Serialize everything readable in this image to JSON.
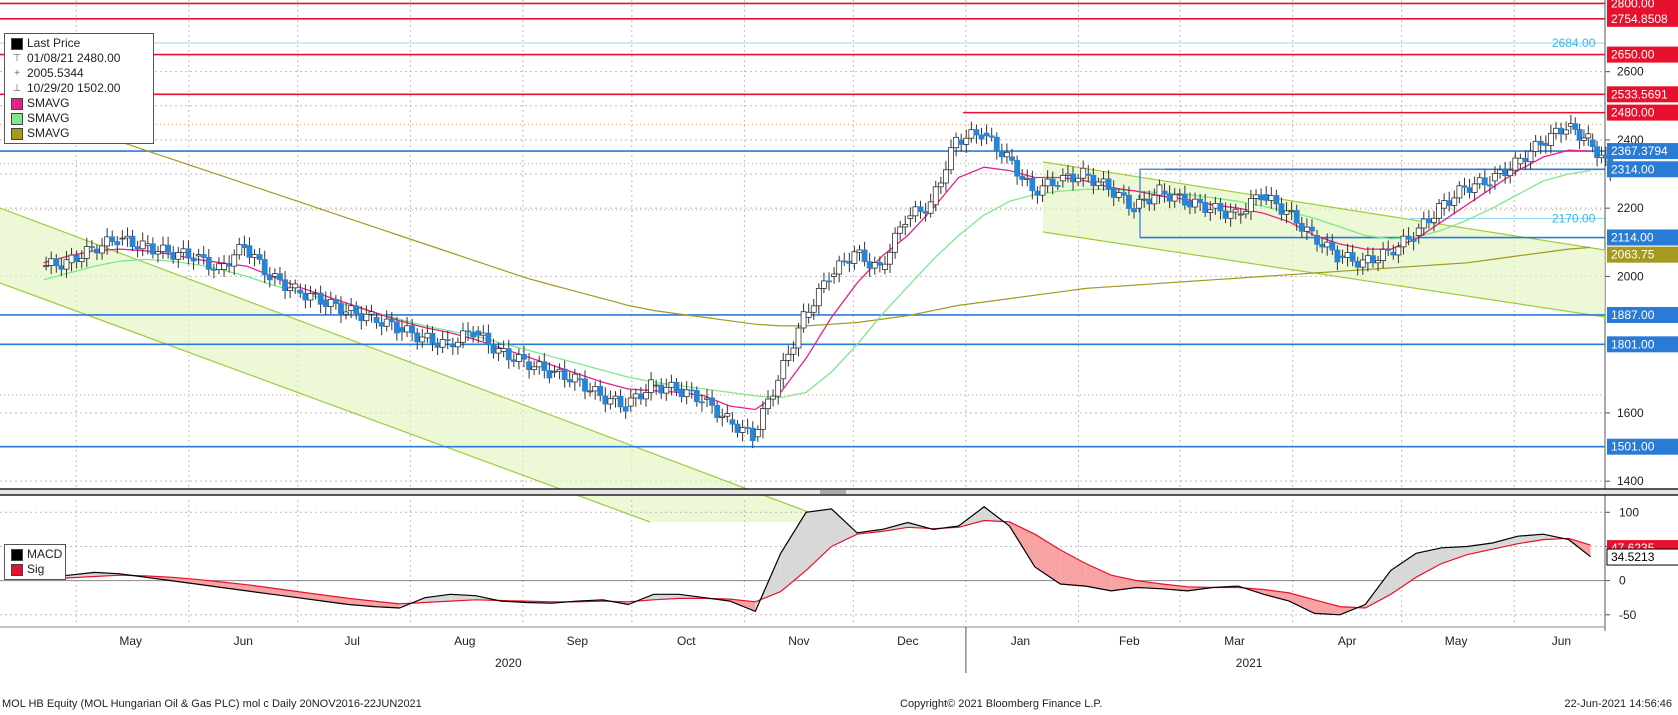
{
  "chart_data": {
    "type": "candlestick",
    "price_panel": {
      "yticks": [
        1400,
        1600,
        2000,
        2200,
        2400,
        2600
      ],
      "ylim": [
        1380,
        2810
      ],
      "candles_weekly_close": [
        {
          "date": "2020-04-22",
          "value": 2040
        },
        {
          "date": "2020-04-29",
          "value": 2080
        },
        {
          "date": "2020-05-06",
          "value": 2110
        },
        {
          "date": "2020-05-13",
          "value": 2090
        },
        {
          "date": "2020-05-20",
          "value": 2070
        },
        {
          "date": "2020-05-27",
          "value": 2060
        },
        {
          "date": "2020-06-03",
          "value": 2020
        },
        {
          "date": "2020-06-10",
          "value": 2090
        },
        {
          "date": "2020-06-17",
          "value": 2000
        },
        {
          "date": "2020-06-24",
          "value": 1960
        },
        {
          "date": "2020-07-01",
          "value": 1930
        },
        {
          "date": "2020-07-08",
          "value": 1900
        },
        {
          "date": "2020-07-15",
          "value": 1880
        },
        {
          "date": "2020-07-22",
          "value": 1850
        },
        {
          "date": "2020-07-29",
          "value": 1820
        },
        {
          "date": "2020-08-05",
          "value": 1800
        },
        {
          "date": "2020-08-12",
          "value": 1840
        },
        {
          "date": "2020-08-19",
          "value": 1780
        },
        {
          "date": "2020-08-26",
          "value": 1750
        },
        {
          "date": "2020-09-02",
          "value": 1720
        },
        {
          "date": "2020-09-09",
          "value": 1700
        },
        {
          "date": "2020-09-16",
          "value": 1650
        },
        {
          "date": "2020-09-23",
          "value": 1620
        },
        {
          "date": "2020-09-30",
          "value": 1680
        },
        {
          "date": "2020-10-07",
          "value": 1670
        },
        {
          "date": "2020-10-14",
          "value": 1640
        },
        {
          "date": "2020-10-21",
          "value": 1580
        },
        {
          "date": "2020-10-28",
          "value": 1530
        },
        {
          "date": "2020-11-04",
          "value": 1700
        },
        {
          "date": "2020-11-11",
          "value": 1880
        },
        {
          "date": "2020-11-18",
          "value": 2000
        },
        {
          "date": "2020-11-25",
          "value": 2070
        },
        {
          "date": "2020-12-02",
          "value": 2020
        },
        {
          "date": "2020-12-09",
          "value": 2170
        },
        {
          "date": "2020-12-16",
          "value": 2210
        },
        {
          "date": "2020-12-23",
          "value": 2400
        },
        {
          "date": "2020-12-30",
          "value": 2420
        },
        {
          "date": "2021-01-06",
          "value": 2350
        },
        {
          "date": "2021-01-13",
          "value": 2250
        },
        {
          "date": "2021-01-20",
          "value": 2280
        },
        {
          "date": "2021-01-27",
          "value": 2300
        },
        {
          "date": "2021-02-03",
          "value": 2260
        },
        {
          "date": "2021-02-10",
          "value": 2200
        },
        {
          "date": "2021-02-17",
          "value": 2250
        },
        {
          "date": "2021-02-24",
          "value": 2220
        },
        {
          "date": "2021-03-03",
          "value": 2200
        },
        {
          "date": "2021-03-10",
          "value": 2180
        },
        {
          "date": "2021-03-17",
          "value": 2240
        },
        {
          "date": "2021-03-24",
          "value": 2190
        },
        {
          "date": "2021-03-31",
          "value": 2120
        },
        {
          "date": "2021-04-07",
          "value": 2060
        },
        {
          "date": "2021-04-14",
          "value": 2040
        },
        {
          "date": "2021-04-21",
          "value": 2070
        },
        {
          "date": "2021-04-28",
          "value": 2120
        },
        {
          "date": "2021-05-05",
          "value": 2200
        },
        {
          "date": "2021-05-12",
          "value": 2260
        },
        {
          "date": "2021-05-19",
          "value": 2280
        },
        {
          "date": "2021-05-26",
          "value": 2330
        },
        {
          "date": "2021-06-02",
          "value": 2390
        },
        {
          "date": "2021-06-09",
          "value": 2440
        },
        {
          "date": "2021-06-16",
          "value": 2400
        },
        {
          "date": "2021-06-22",
          "value": 2314
        }
      ],
      "sma_20": [
        2040,
        2060,
        2075,
        2080,
        2075,
        2065,
        2050,
        2040,
        2030,
        2000,
        1970,
        1945,
        1920,
        1895,
        1870,
        1850,
        1835,
        1815,
        1790,
        1765,
        1740,
        1715,
        1690,
        1670,
        1665,
        1660,
        1650,
        1620,
        1610,
        1660,
        1760,
        1880,
        1980,
        2060,
        2120,
        2200,
        2290,
        2320,
        2310,
        2290,
        2290,
        2280,
        2260,
        2250,
        2235,
        2225,
        2210,
        2200,
        2185,
        2160,
        2120,
        2095,
        2080,
        2080,
        2110,
        2160,
        2210,
        2260,
        2310,
        2350,
        2370,
        2367
      ],
      "sma_50": [
        1990,
        2010,
        2030,
        2045,
        2050,
        2045,
        2035,
        2020,
        2000,
        1975,
        1955,
        1935,
        1915,
        1895,
        1875,
        1855,
        1840,
        1825,
        1805,
        1785,
        1765,
        1745,
        1725,
        1705,
        1690,
        1680,
        1670,
        1660,
        1650,
        1645,
        1660,
        1720,
        1800,
        1890,
        1970,
        2050,
        2120,
        2180,
        2220,
        2240,
        2250,
        2255,
        2255,
        2250,
        2245,
        2240,
        2230,
        2220,
        2205,
        2190,
        2170,
        2145,
        2120,
        2110,
        2115,
        2135,
        2165,
        2200,
        2240,
        2280,
        2300,
        2310
      ],
      "sma_200": [
        2460,
        2440,
        2420,
        2395,
        2370,
        2345,
        2320,
        2295,
        2270,
        2245,
        2220,
        2195,
        2170,
        2145,
        2120,
        2095,
        2070,
        2045,
        2020,
        1995,
        1975,
        1955,
        1935,
        1915,
        1900,
        1890,
        1880,
        1870,
        1860,
        1855,
        1855,
        1860,
        1865,
        1875,
        1885,
        1900,
        1915,
        1925,
        1935,
        1945,
        1955,
        1965,
        1970,
        1975,
        1980,
        1985,
        1990,
        1995,
        2000,
        2005,
        2010,
        2015,
        2020,
        2025,
        2030,
        2035,
        2040,
        2050,
        2060,
        2070,
        2080,
        2085
      ],
      "horizontal_levels": [
        {
          "value": 2800,
          "label": "2800.00",
          "color": "#e8112d"
        },
        {
          "value": 2754.85,
          "label": "2754.8508",
          "color": "#e8112d"
        },
        {
          "value": 2684,
          "label": "2684.00",
          "color": "#36b6e8"
        },
        {
          "value": 2650,
          "label": "2650.00",
          "color": "#e8112d"
        },
        {
          "value": 2533.57,
          "label": "2533.5691",
          "color": "#e8112d"
        },
        {
          "value": 2480,
          "label": "2480.00",
          "color": "#e8112d"
        },
        {
          "value": 2367.38,
          "label": "2367.3794",
          "color": "#2a7bd6"
        },
        {
          "value": 2314,
          "label": "2314.00",
          "color": "#2a7bd6"
        },
        {
          "value": 2170,
          "label": "2170.00",
          "color": "#36b6e8"
        },
        {
          "value": 2114,
          "label": "2114.00",
          "color": "#2a7bd6"
        },
        {
          "value": 2063.75,
          "label": "2063.75",
          "color": "#a39a1e"
        },
        {
          "value": 1887,
          "label": "1887.00",
          "color": "#2a7bd6"
        },
        {
          "value": 1801,
          "label": "1801.00",
          "color": "#2a7bd6"
        },
        {
          "value": 1501,
          "label": "1501.00",
          "color": "#2a7bd6"
        }
      ],
      "legend": {
        "title": "Last Price",
        "high": "01/08/21 2480.00",
        "average": "2005.5344",
        "low": "10/29/20 1502.00",
        "series": [
          {
            "name": "SMAVG",
            "color": "#e8208e"
          },
          {
            "name": "SMAVG",
            "color": "#7fe88a"
          },
          {
            "name": "SMAVG",
            "color": "#a39a1e"
          }
        ]
      }
    },
    "macd_panel": {
      "yticks": [
        -50,
        0,
        50,
        100
      ],
      "ylim": [
        -62,
        118
      ],
      "macd": [
        5,
        8,
        12,
        10,
        5,
        0,
        -5,
        -10,
        -15,
        -20,
        -25,
        -30,
        -35,
        -38,
        -40,
        -25,
        -20,
        -22,
        -30,
        -32,
        -33,
        -30,
        -28,
        -35,
        -20,
        -20,
        -25,
        -30,
        -45,
        40,
        100,
        105,
        70,
        75,
        85,
        75,
        80,
        108,
        80,
        20,
        -5,
        -8,
        -15,
        -10,
        -12,
        -15,
        -10,
        -8,
        -20,
        -30,
        -48,
        -50,
        -35,
        15,
        40,
        48,
        50,
        55,
        65,
        68,
        60,
        35
      ],
      "signal": [
        2,
        4,
        6,
        8,
        7,
        5,
        2,
        -2,
        -6,
        -11,
        -16,
        -21,
        -26,
        -30,
        -34,
        -32,
        -30,
        -28,
        -29,
        -30,
        -31,
        -31,
        -30,
        -31,
        -28,
        -26,
        -26,
        -27,
        -31,
        -16,
        15,
        50,
        68,
        72,
        78,
        76,
        78,
        88,
        86,
        68,
        45,
        25,
        8,
        0,
        -5,
        -9,
        -10,
        -10,
        -13,
        -18,
        -28,
        -38,
        -40,
        -20,
        5,
        25,
        38,
        46,
        54,
        60,
        62,
        52
      ],
      "legend": [
        {
          "name": "MACD",
          "color": "#000000",
          "value": "47.6235"
        },
        {
          "name": "Sig",
          "color": "#e8112d",
          "value": "34.5213"
        }
      ]
    },
    "x_axis": {
      "months": [
        "May",
        "Jun",
        "Jul",
        "Aug",
        "Sep",
        "Oct",
        "Nov",
        "Dec",
        "Jan",
        "Feb",
        "Mar",
        "Apr",
        "May",
        "Jun"
      ],
      "years": [
        "2020",
        "2021"
      ]
    }
  },
  "footer": {
    "left": "MOL HB Equity (MOL Hungarian Oil & Gas PLC) mol c  Daily 20NOV2016-22JUN2021",
    "center": "Copyright© 2021 Bloomberg Finance L.P.",
    "right": "22-Jun-2021 14:56:46"
  }
}
